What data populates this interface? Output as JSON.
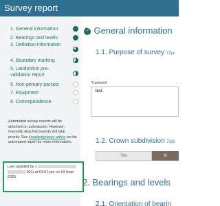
{
  "header": {
    "title": "Survey report"
  },
  "sidebar": {
    "items": [
      {
        "label": "1. General information",
        "status": "complete"
      },
      {
        "label": "2. Bearings and levels",
        "status": "complete"
      },
      {
        "label": "3. Definition information",
        "status": "partial"
      },
      {
        "label": "4. Boundary marking",
        "status": "partial"
      },
      {
        "label": "5. Landonline pre-validation report",
        "status": "partial"
      },
      {
        "label": "6. Non-primary parcels",
        "status": "none"
      },
      {
        "label": "7. Equipment",
        "status": "none"
      },
      {
        "label": "8. Correspondence",
        "status": "none"
      }
    ],
    "note_text": "Automated survey reports will be attached on submission. However, manually attached reports will take priority.",
    "note_see": "See",
    "note_link": "knowledgebase article",
    "note_suffix": "on the automated report for more information.",
    "updated_prefix": "Last updated by J",
    "updated_suffix": "001) at 03:01 pm on 18 Sept 2025."
  },
  "main": {
    "section1": {
      "number": "1.",
      "title": "General information"
    },
    "purpose": {
      "title": "1.1. Purpose of survey",
      "ref": "72(a"
    },
    "comment": {
      "label": "Comment",
      "value": "test"
    },
    "crown": {
      "title": "1.2. Crown subdivision",
      "ref": "72(b"
    },
    "yes_label": "Yes",
    "no_label": "N",
    "section2": {
      "number": "2.",
      "title": "Bearings and levels"
    },
    "orientation": {
      "title": "2.1. Orientation of bearin"
    }
  },
  "colors": {
    "brand": "#2f6f8f",
    "accent": "#1f7a65",
    "highlight": "#19a24d"
  }
}
